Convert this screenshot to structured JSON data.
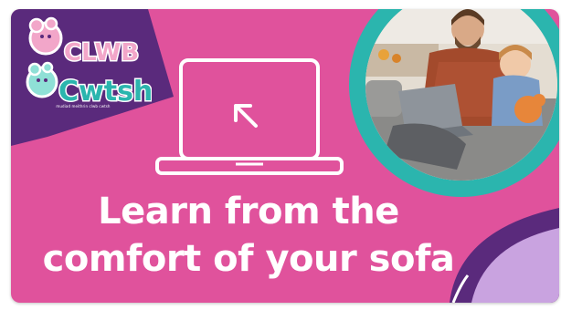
{
  "brand": {
    "logo_line1": "CLWB",
    "logo_line2": "Cwtsh",
    "tagline": "mudiad meithrin clwb cwtsh"
  },
  "headline": {
    "line1": "Learn from the",
    "line2": "comfort of your sofa"
  },
  "icons": {
    "laptop": "laptop-icon",
    "cursor": "cursor-arrow-icon"
  },
  "colors": {
    "background": "#e0529c",
    "corner_purple": "#5a2a7c",
    "ring_teal": "#2bb5ae",
    "lilac": "#c9a3e0",
    "white": "#ffffff"
  }
}
